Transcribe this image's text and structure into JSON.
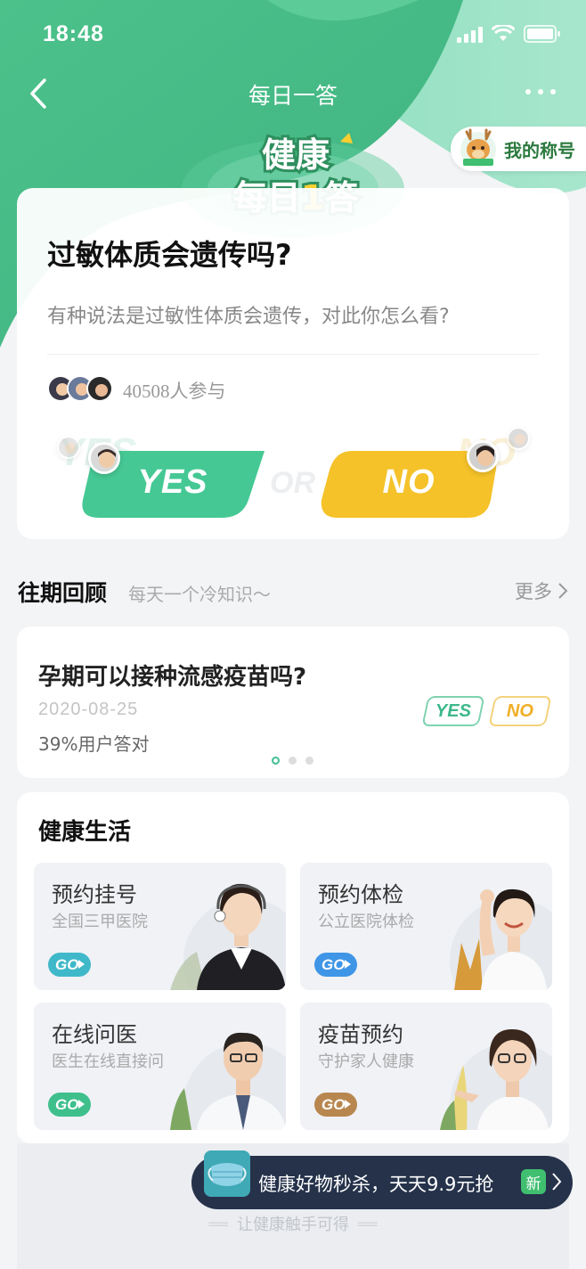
{
  "status_bar": {
    "time": "18:48"
  },
  "nav": {
    "title": "每日一答"
  },
  "logo": {
    "line1": "健康",
    "line2_a": "每日",
    "line2_b": "1",
    "line2_c": "答"
  },
  "my_title_badge": {
    "label": "我的称号"
  },
  "question": {
    "title": "过敏体质会遗传吗?",
    "description": "有种说法是过敏性体质会遗传，对此你怎么看?",
    "participants": "40508人参与",
    "yes_label": "YES",
    "or_label": "OR",
    "no_label": "NO"
  },
  "past_review": {
    "title": "往期回顾",
    "subtitle": "每天一个冷知识～",
    "more": "更多",
    "item": {
      "question": "孕期可以接种流感疫苗吗?",
      "date": "2020-08-25",
      "correct_rate": "39%用户答对",
      "yes_tag": "YES",
      "no_tag": "NO"
    },
    "pagination": {
      "count": 3,
      "active": 1
    }
  },
  "health_life": {
    "title": "健康生活",
    "tiles": [
      {
        "title": "预约挂号",
        "subtitle": "全国三甲医院",
        "go": "GO",
        "go_color": "#3fb8c9",
        "icon": "doctor-receptionist"
      },
      {
        "title": "预约体检",
        "subtitle": "公立医院体检",
        "go": "GO",
        "go_color": "#3f95e6",
        "icon": "fitness-woman"
      },
      {
        "title": "在线问医",
        "subtitle": "医生在线直接问",
        "go": "GO",
        "go_color": "#3fbf8c",
        "icon": "male-doctor"
      },
      {
        "title": "疫苗预约",
        "subtitle": "守护家人健康",
        "go": "GO",
        "go_color": "#b8874f",
        "icon": "vaccine-woman"
      }
    ]
  },
  "promo": {
    "text": "健康好物秒杀，天天9.9元抢",
    "badge": "新"
  },
  "footer": {
    "slogan": "让健康触手可得"
  },
  "colors": {
    "brand_green": "#3fbf8c",
    "yes_green": "#45c894",
    "no_yellow": "#f5c22a",
    "promo_bg": "#25324a"
  }
}
